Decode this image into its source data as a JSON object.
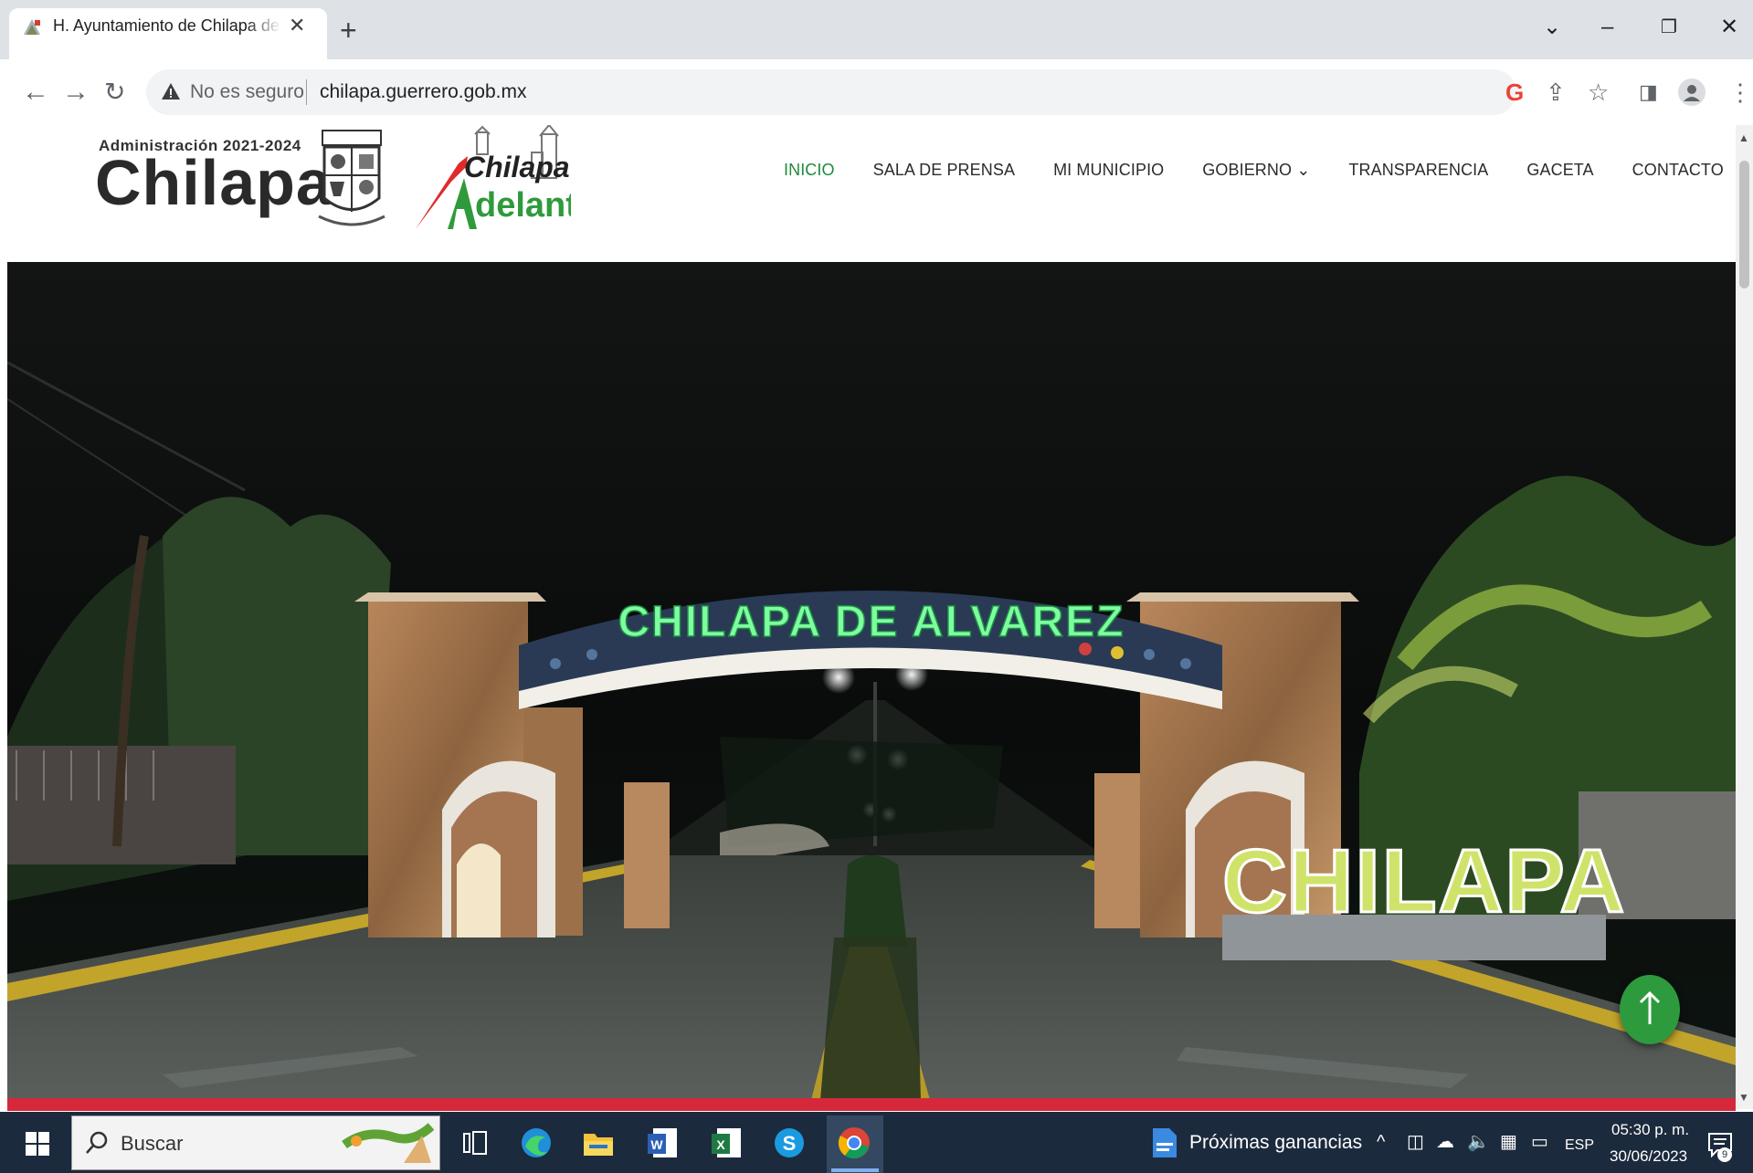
{
  "browser": {
    "tab_title": "H. Ayuntamiento de Chilapa de Álvarez",
    "tab_close": "✕",
    "new_tab": "+",
    "security_label": "No es seguro",
    "url": "chilapa.guerrero.gob.mx"
  },
  "site": {
    "admin_label": "Administración 2021-2024",
    "brand": "Chilapa",
    "logo_top": "Chilapa",
    "logo_bottom": "delante",
    "nav": [
      {
        "label": "INICIO",
        "active": true
      },
      {
        "label": "SALA DE PRENSA"
      },
      {
        "label": "MI MUNICIPIO"
      },
      {
        "label": "GOBIERNO ⌄"
      },
      {
        "label": "TRANSPARENCIA"
      },
      {
        "label": "GACETA"
      },
      {
        "label": "CONTACTO"
      }
    ],
    "hero": {
      "arch_sign": "CHILAPA DE ALVAREZ",
      "letters_sign": "CHILAPA"
    }
  },
  "taskbar": {
    "search_placeholder": "Buscar",
    "news": "Próximas ganancias",
    "language": "ESP",
    "time": "05:30 p. m.",
    "date": "30/06/2023",
    "notifications": "9"
  },
  "colors": {
    "accent_green": "#1f8a3a",
    "red_strip": "#d5283b",
    "taskbar": "#1c2a3d",
    "tab_strip": "#dee1e6"
  },
  "icons": [
    "back-icon",
    "forward-icon",
    "reload-icon",
    "warning-icon",
    "google-icon",
    "share-icon",
    "star-icon",
    "side-panel-icon",
    "profile-icon",
    "menu-icon",
    "windows-start-icon",
    "search-icon",
    "task-view-icon",
    "edge-icon",
    "file-explorer-icon",
    "word-icon",
    "excel-icon",
    "skype-icon",
    "chrome-icon",
    "arrow-up-icon"
  ]
}
